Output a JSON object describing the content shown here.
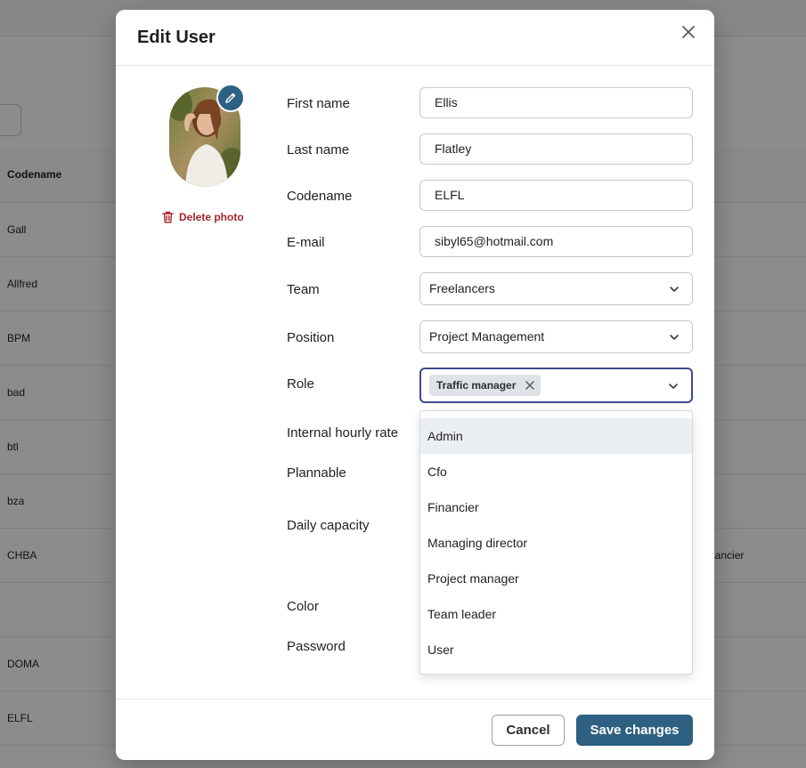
{
  "background": {
    "column_header": "Codename",
    "rows": [
      "Gall",
      "Allfred",
      "BPM",
      "bad",
      "btl",
      "bza",
      "CHBA",
      "",
      "DOMA",
      "ELFL"
    ],
    "row_extra": "nancier"
  },
  "modal": {
    "title": "Edit User",
    "delete_photo_label": "Delete photo",
    "fields": {
      "first_name_label": "First name",
      "first_name_value": "Ellis",
      "last_name_label": "Last name",
      "last_name_value": "Flatley",
      "codename_label": "Codename",
      "codename_value": "ELFL",
      "email_label": "E-mail",
      "email_value": "sibyl65@hotmail.com",
      "team_label": "Team",
      "team_value": "Freelancers",
      "position_label": "Position",
      "position_value": "Project Management",
      "role_label": "Role",
      "role_chip": "Traffic manager",
      "hourly_rate_label": "Internal hourly rate",
      "plannable_label": "Plannable",
      "daily_capacity_label": "Daily capacity",
      "color_label": "Color",
      "password_label": "Password"
    },
    "role_options": [
      "Admin",
      "Cfo",
      "Financier",
      "Managing director",
      "Project manager",
      "Team leader",
      "User"
    ],
    "cancel_label": "Cancel",
    "save_label": "Save changes"
  },
  "colors": {
    "primary": "#2d6081",
    "danger": "#a4262c",
    "focus": "#3f4a8a"
  },
  "icons": {
    "close": "close-icon",
    "edit": "pencil-icon",
    "delete": "trash-icon",
    "chevron": "chevron-down-icon",
    "chip_remove": "close-icon"
  }
}
